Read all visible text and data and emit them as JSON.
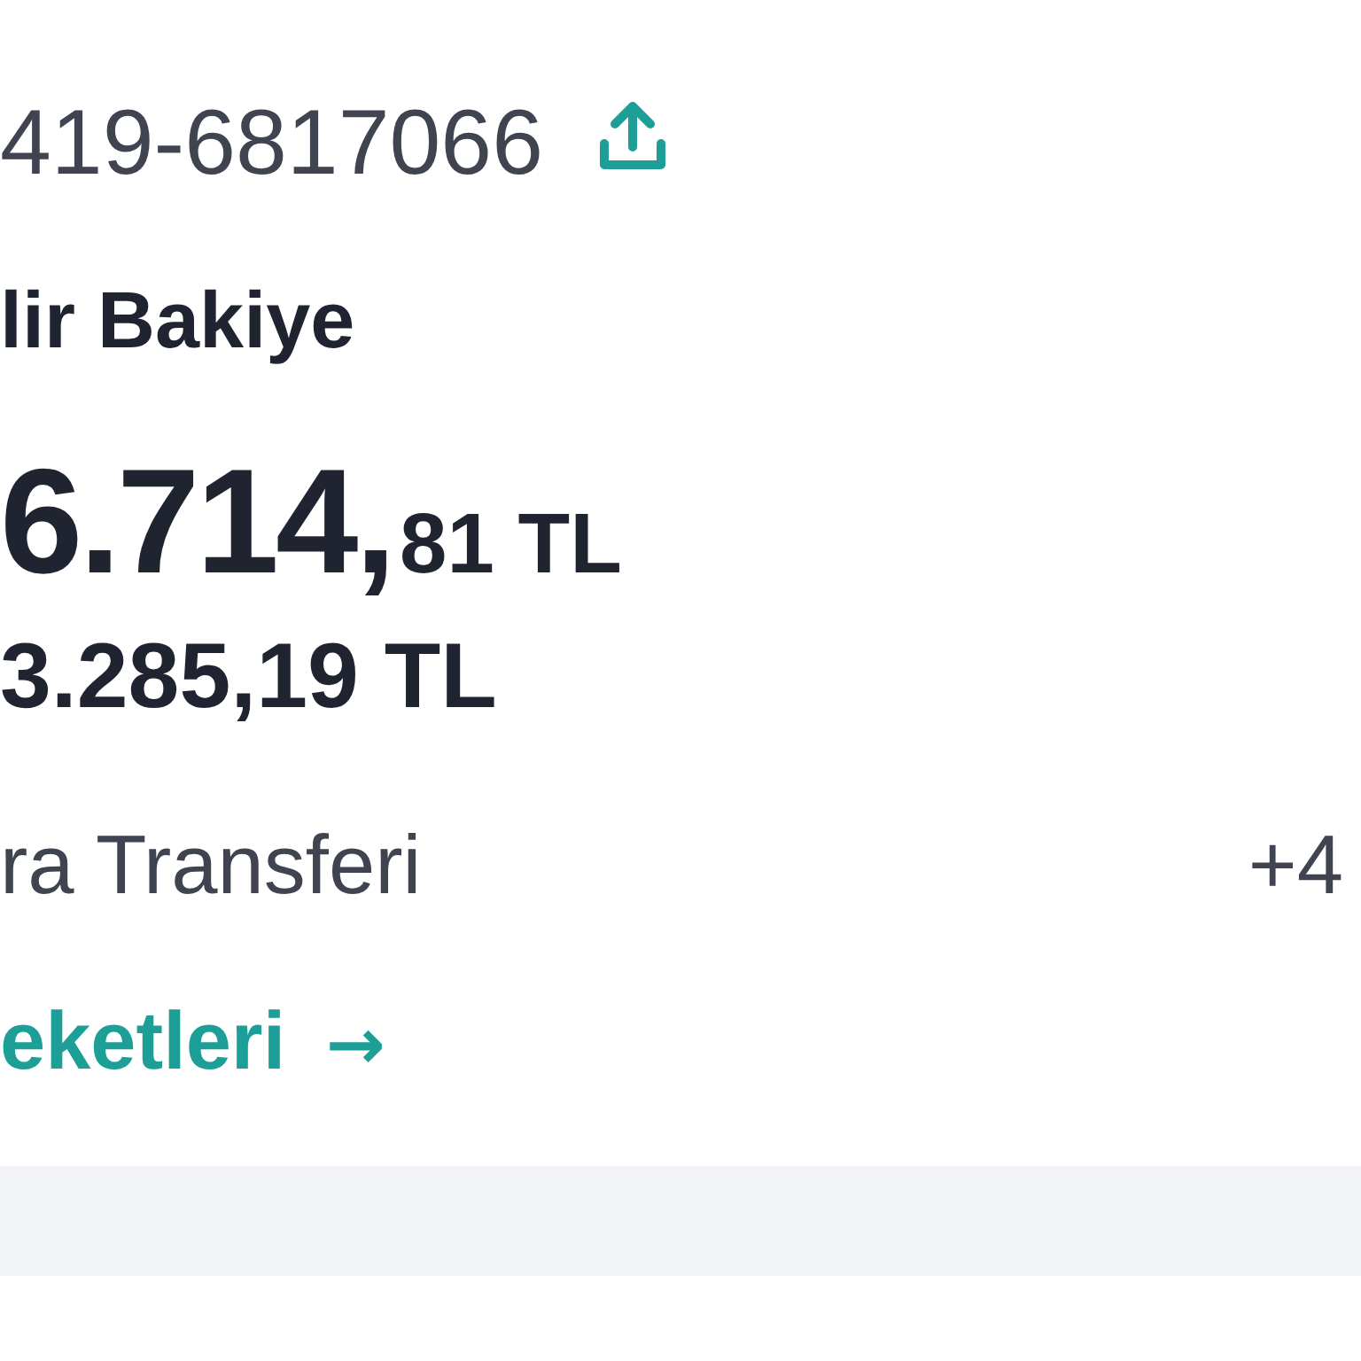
{
  "account": {
    "number": "419-6817066"
  },
  "balance": {
    "label": "lir Bakiye",
    "amount_main": "6.714,",
    "amount_decimal": "81 TL"
  },
  "secondary_amount": "3.285,19 TL",
  "transaction": {
    "description": "ra Transferi",
    "amount": "+4"
  },
  "link": {
    "label": "eketleri",
    "arrow": "→"
  }
}
